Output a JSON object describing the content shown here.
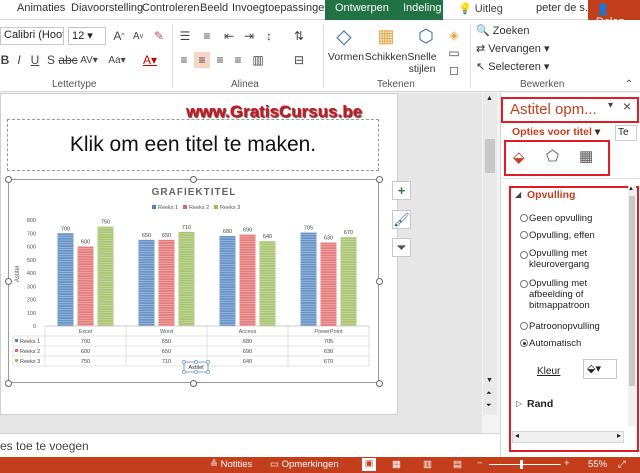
{
  "ribbon_tabs": [
    "Animaties",
    "Diavoorstelling",
    "Controleren",
    "Beeld",
    "Invoegtoepassingen",
    "Ontwerpen",
    "Indeling"
  ],
  "tell_me": "Uitleg",
  "user": "peter de s...",
  "share": "Delen",
  "font": {
    "name": "Calibri (Hoofdt",
    "size": "12"
  },
  "groups": {
    "lettertype": "Lettertype",
    "alinea": "Alinea",
    "tekenen": "Tekenen",
    "bewerken": "Bewerken"
  },
  "drawing": {
    "vormen": "Vormen",
    "schikken": "Schikken",
    "snelle_stijlen": "Snelle stijlen"
  },
  "editing": {
    "zoeken": "Zoeken",
    "vervangen": "Vervangen",
    "selecteren": "Selecteren"
  },
  "watermark": "www.GratisCursus.be",
  "slide_title_placeholder": "Klik om een titel te maken.",
  "notes_placeholder": "es toe te voegen",
  "status": {
    "notities": "Notities",
    "opmerkingen": "Opmerkingen",
    "zoom": "55%"
  },
  "pane": {
    "title": "Astitel opm...",
    "options_dropdown": "Opties voor titel",
    "options_tab_cut": "Te",
    "section_fill": "Opvulling",
    "fill_options": [
      "Geen opvulling",
      "Opvulling, effen",
      "Opvulling met kleurovergang",
      "Opvulling met afbeelding of bitmappatroon",
      "Patroonopvulling",
      "Automatisch"
    ],
    "selected_fill": "Automatisch",
    "color_label": "Kleur",
    "section_border": "Rand"
  },
  "chart_data": {
    "type": "bar",
    "title": "GRAFIEKTITEL",
    "categories": [
      "Excel",
      "Word",
      "Access",
      "PowerPoint"
    ],
    "series": [
      {
        "name": "Reeks 1",
        "values": [
          700,
          650,
          680,
          705
        ],
        "color": "#4f81bd"
      },
      {
        "name": "Reeks 2",
        "values": [
          600,
          650,
          690,
          630
        ],
        "color": "#e06666"
      },
      {
        "name": "Reeks 3",
        "values": [
          750,
          710,
          640,
          670
        ],
        "color": "#9bbb59"
      }
    ],
    "ylim": [
      0,
      800
    ],
    "yticks": [
      0,
      100,
      200,
      300,
      400,
      500,
      600,
      700,
      800
    ],
    "ylabel": "Astitel",
    "xlabel_selected": "Astitel",
    "legend": "top",
    "data_table": true
  }
}
